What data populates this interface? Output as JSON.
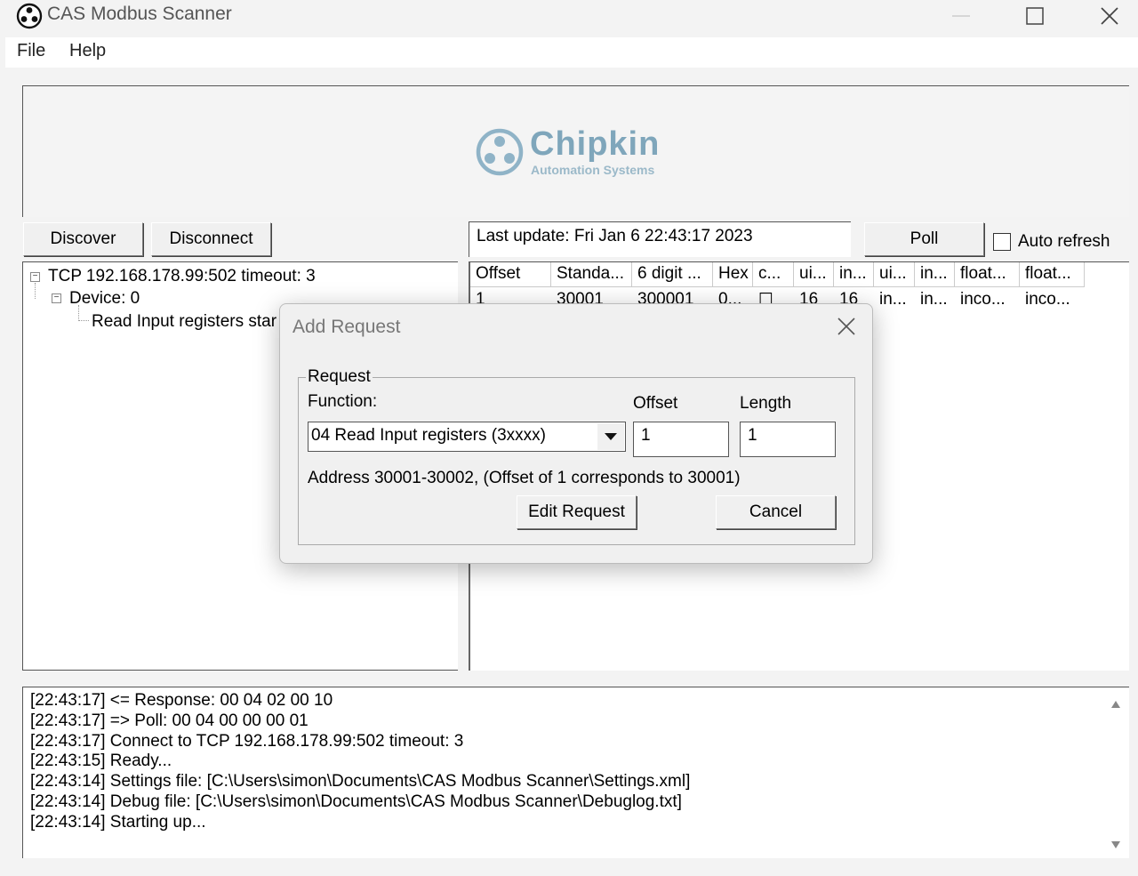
{
  "window": {
    "title": "CAS Modbus Scanner"
  },
  "menu": {
    "items": [
      "File",
      "Help"
    ]
  },
  "logo": {
    "name": "Chipkin",
    "subtitle": "Automation Systems"
  },
  "toolbar": {
    "discover_label": "Discover",
    "disconnect_label": "Disconnect",
    "last_update": "Last update: Fri Jan  6 22:43:17 2023",
    "poll_label": "Poll",
    "auto_refresh_label": "Auto refresh",
    "auto_refresh_checked": false
  },
  "tree": {
    "connection": "TCP 192.168.178.99:502 timeout: 3",
    "device": "Device: 0",
    "request": "Read Input registers star"
  },
  "grid": {
    "columns": [
      "Offset",
      "Standa...",
      "6 digit ...",
      "Hex",
      "c...",
      "ui...",
      "in...",
      "ui...",
      "in...",
      "float...",
      "float..."
    ],
    "rows": [
      [
        "1",
        "30001",
        "300001",
        "0...",
        "☐",
        "16",
        "16",
        "in...",
        "in...",
        "inco...",
        "inco..."
      ]
    ]
  },
  "log": {
    "lines": [
      "[22:43:17] <= Response: 00 04 02 00 10",
      "[22:43:17] => Poll: 00 04 00 00 00 01",
      "[22:43:17] Connect to TCP 192.168.178.99:502 timeout: 3",
      "[22:43:15] Ready...",
      "[22:43:14] Settings file:  [C:\\Users\\simon\\Documents\\CAS Modbus Scanner\\Settings.xml]",
      "[22:43:14] Debug file:  [C:\\Users\\simon\\Documents\\CAS Modbus Scanner\\Debuglog.txt]",
      "[22:43:14] Starting up..."
    ]
  },
  "dialog": {
    "title": "Add Request",
    "group_label": "Request",
    "function_label": "Function:",
    "function_value": "04 Read Input registers (3xxxx)",
    "offset_label": "Offset",
    "offset_value": "1",
    "length_label": "Length",
    "length_value": "1",
    "address_text": "Address 30001-30002, (Offset of 1 corresponds to 30001)",
    "edit_label": "Edit Request",
    "cancel_label": "Cancel"
  }
}
